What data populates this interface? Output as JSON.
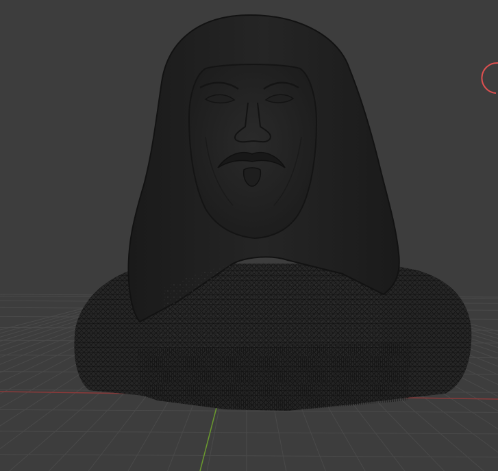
{
  "viewport": {
    "view": "3d-viewport",
    "background_color": "#3d3d3d",
    "grid_color": "#4a4a4a",
    "x_axis_color": "#8b3a3a",
    "y_axis_color": "#6a9a2e",
    "model": {
      "name": "bust",
      "display": "mesh-with-wireframe",
      "surface_color": "#232323",
      "wire_color": "#151515"
    },
    "gizmo": {
      "icon": "navigation-gizmo-icon",
      "color": "#e05050"
    }
  }
}
